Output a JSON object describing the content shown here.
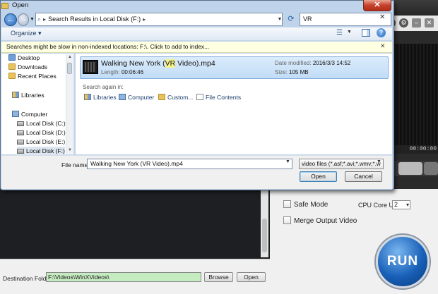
{
  "background_app": {
    "time_display": "00:00:00",
    "options": {
      "safe_mode_label": "Safe Mode",
      "cpu_core_label": "CPU Core Use:",
      "cpu_core_value": "2",
      "merge_output_label": "Merge Output Video"
    },
    "run_label": "RUN",
    "destination": {
      "label": "Destination Folder:",
      "value": "F:\\Videos\\WinXVideos\\",
      "browse_label": "Browse",
      "open_label": "Open"
    }
  },
  "dialog": {
    "title": "Open",
    "close_label": "✕",
    "address": {
      "parts": [
        "Search Results in Local Disk (F:)"
      ]
    },
    "search_value": "VR",
    "toolbar": {
      "organize_label": "Organize ▾"
    },
    "infobar_text": "Searches might be slow in non-indexed locations: F:\\. Click to add to index...",
    "nav_items": [
      {
        "label": "Desktop",
        "icon": "desktop-icon"
      },
      {
        "label": "Downloads",
        "icon": "downloads-icon"
      },
      {
        "label": "Recent Places",
        "icon": "recent-places-icon"
      },
      {
        "label": "Libraries",
        "icon": "libraries-icon"
      },
      {
        "label": "Computer",
        "icon": "computer-icon"
      },
      {
        "label": "Local Disk (C:)",
        "icon": "disk-icon"
      },
      {
        "label": "Local Disk (D:)",
        "icon": "disk-icon"
      },
      {
        "label": "Local Disk (E:)",
        "icon": "disk-icon"
      },
      {
        "label": "Local Disk (F:)",
        "icon": "disk-icon",
        "selected": true
      }
    ],
    "result": {
      "name_before": "Walking New York (",
      "name_highlight": "VR",
      "name_after": " Video).mp4",
      "length_label": "Length:",
      "length_value": "00:06:46",
      "date_label": "Date modified:",
      "date_value": "2016/3/3 14:52",
      "size_label": "Size:",
      "size_value": "105 MB"
    },
    "search_again": {
      "label": "Search again in:",
      "links": [
        "Libraries",
        "Computer",
        "Custom...",
        "File Contents"
      ]
    },
    "file_name_label": "File name:",
    "file_name_value": "Walking New York (VR Video).mp4",
    "file_type_value": "video files (*.asf;*.avi;*.wmv;*.w",
    "open_button": "Open",
    "cancel_button": "Cancel"
  },
  "colors": {
    "dialog_frame": "#bfd3ea",
    "selection": "#c1dcf6",
    "highlight": "#f6f389",
    "run_button": "#1860b8",
    "destination_field": "#c5ebc0"
  }
}
